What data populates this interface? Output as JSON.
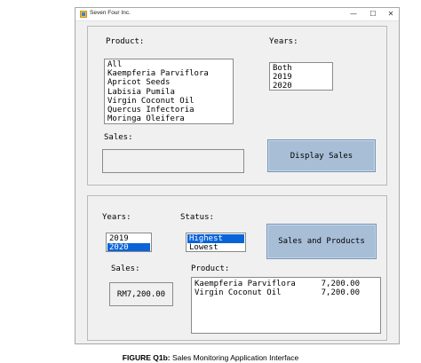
{
  "window": {
    "title": "Seven Four Inc.",
    "controls": {
      "minimize": "—",
      "maximize": "☐",
      "close": "✕"
    }
  },
  "top_panel": {
    "product_label": "Product:",
    "products": [
      "All",
      "Kaempferia Parviflora",
      "Apricot Seeds",
      "Labisia Pumila",
      "Virgin Coconut Oil",
      "Quercus Infectoria",
      "Moringa Oleifera"
    ],
    "years_label": "Years:",
    "years": [
      "Both",
      "2019",
      "2020"
    ],
    "sales_label": "Sales:",
    "sales_value": "",
    "display_button": "Display Sales"
  },
  "bottom_panel": {
    "years_label": "Years:",
    "years": [
      "2019",
      "2020"
    ],
    "years_selected": "2020",
    "status_label": "Status:",
    "status": [
      "Highest",
      "Lowest"
    ],
    "status_selected": "Highest",
    "sales_products_button": "Sales and Products",
    "sales_label": "Sales:",
    "sales_value": "RM7,200.00",
    "product_label": "Product:",
    "results": [
      {
        "name": "Kaempferia Parviflora",
        "amount": "7,200.00"
      },
      {
        "name": "Virgin Coconut Oil",
        "amount": "7,200.00"
      }
    ]
  },
  "caption": {
    "figure": "FIGURE Q1b:",
    "text": " Sales Monitoring Application Interface"
  },
  "colors": {
    "button_fill": "#a7bed6",
    "selection": "#0a64d8",
    "form_bg": "#f0f0f0"
  },
  "icons": [
    "app-icon",
    "minimize-icon",
    "maximize-icon",
    "close-icon"
  ]
}
